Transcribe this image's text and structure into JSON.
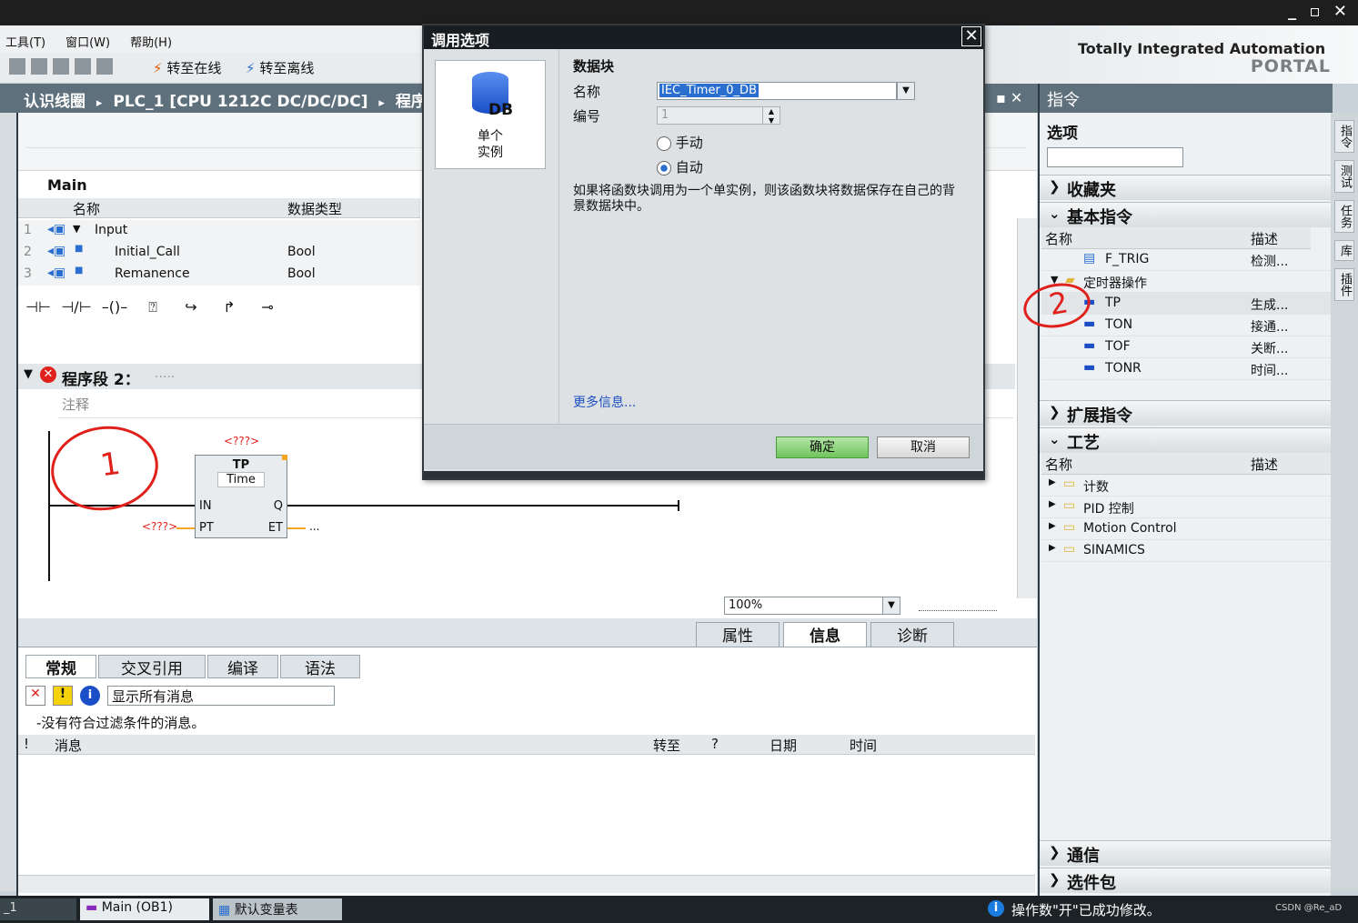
{
  "menu": {
    "items": [
      "工具(T)",
      "窗口(W)",
      "帮助(H)"
    ]
  },
  "toolbar": {
    "go_online": "转至在线",
    "go_offline": "转至离线"
  },
  "tia": {
    "line1": "Totally Integrated Automation",
    "line2": "PORTAL"
  },
  "breadcrumb": {
    "a": "认识线圈",
    "b": "PLC_1 [CPU 1212C DC/DC/DC]",
    "c": "程序块",
    "sep": "▸"
  },
  "editor": {
    "block_name": "Main",
    "col_name": "名称",
    "col_type": "数据类型",
    "rows": [
      {
        "num": "1",
        "name": "Input",
        "type": ""
      },
      {
        "num": "2",
        "name": "Initial_Call",
        "type": "Bool"
      },
      {
        "num": "3",
        "name": "Remanence",
        "type": "Bool"
      }
    ],
    "network_title": "程序段 2：",
    "network_dots": ".....",
    "comment": "注释",
    "block_instance": "<???>",
    "block_type": "TP",
    "block_subtype": "Time",
    "pin_in": "IN",
    "pin_q": "Q",
    "pin_pt": "PT",
    "pin_et": "ET",
    "pt_value": "<???>",
    "et_value": "...",
    "annotation1": "1",
    "zoom": "100%"
  },
  "dialog": {
    "title": "调用选项",
    "icon_text": "DB",
    "icon_label1": "单个",
    "icon_label2": "实例",
    "section": "数据块",
    "name_label": "名称",
    "name_value": "IEC_Timer_0_DB",
    "number_label": "编号",
    "number_value": "1",
    "radio_manual": "手动",
    "radio_auto": "自动",
    "description": "如果将函数块调用为一个单实例，则该函数块将数据保存在自己的背景数据块中。",
    "more_info": "更多信息...",
    "ok": "确定",
    "cancel": "取消"
  },
  "rightpanel": {
    "title": "指令",
    "options": "选项",
    "favorites": "收藏夹",
    "basic": "基本指令",
    "col_name": "名称",
    "col_desc": "描述",
    "basic_items": [
      {
        "name": "F_TRIG",
        "desc": "检测..."
      },
      {
        "name": "定时器操作",
        "desc": ""
      },
      {
        "name": "TP",
        "desc": "生成..."
      },
      {
        "name": "TON",
        "desc": "接通..."
      },
      {
        "name": "TOF",
        "desc": "关断..."
      },
      {
        "name": "TONR",
        "desc": "时间..."
      }
    ],
    "extended": "扩展指令",
    "tech": "工艺",
    "tech_items": [
      "计数",
      "PID 控制",
      "Motion Control",
      "SINAMICS"
    ],
    "comm": "通信",
    "options_pkg": "选件包",
    "annotation2": "2"
  },
  "sidetabs": [
    "指令",
    "测试",
    "任务",
    "库",
    "插件"
  ],
  "inspector": {
    "tabs_top": [
      "属性",
      "信息",
      "诊断"
    ],
    "tabs": [
      "常规",
      "交叉引用",
      "编译",
      "语法"
    ],
    "filter": "显示所有消息",
    "no_messages": "-没有符合过滤条件的消息。",
    "cols": [
      "!",
      "消息",
      "转至",
      "?",
      "日期",
      "时间"
    ]
  },
  "statusbar": {
    "left": "_1",
    "tab1": "Main (OB1)",
    "tab2": "默认变量表",
    "message": "操作数\"开\"已成功修改。",
    "watermark": "CSDN @Re_aD"
  },
  "colors": {
    "header": "#5e707c",
    "ok_green": "#6fc35b",
    "annotation_red": "#e0201a"
  }
}
